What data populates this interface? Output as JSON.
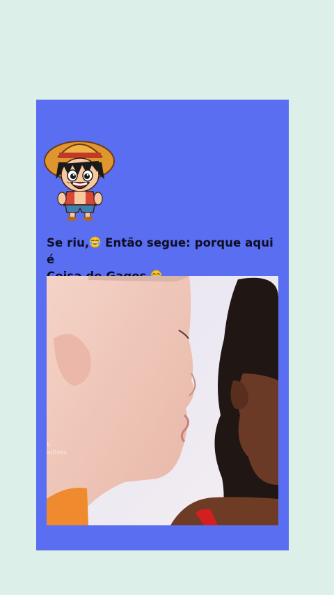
{
  "post": {
    "caption_line1": "Se riu,",
    "caption_line1_rest": " Então segue: porque aqui é",
    "caption_line2": "Coisa de Gagos ",
    "emoji": "tears-of-joy-emoji",
    "watermark": "k\nadizes"
  },
  "colors": {
    "background": "#dcefe9",
    "card": "#5a6ef2",
    "caption_text": "#0e0e22"
  },
  "icons": {
    "avatar": "straw-hat-cartoon-avatar",
    "emoji": "tears-of-joy-emoji"
  }
}
